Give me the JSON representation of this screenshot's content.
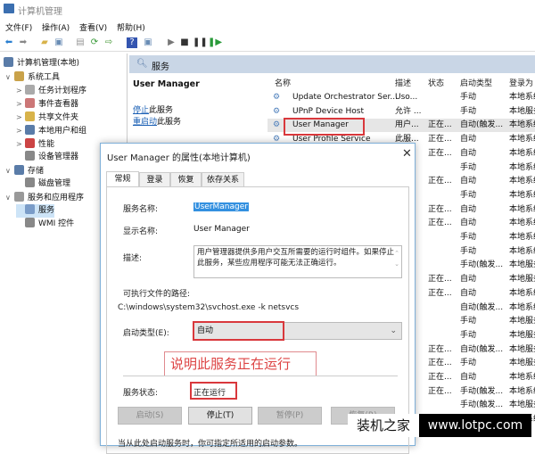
{
  "window": {
    "title": "计算机管理"
  },
  "menu": [
    "文件(F)",
    "操作(A)",
    "查看(V)",
    "帮助(H)"
  ],
  "toolbar": [
    {
      "icon": "back-arrow-icon",
      "g": "⬅",
      "c": "#2a7fd0"
    },
    {
      "icon": "forward-arrow-icon",
      "g": "➡",
      "c": "#888"
    },
    {
      "icon": "up-folder-icon",
      "g": "▰",
      "c": "#d8b34a"
    },
    {
      "icon": "show-hide-tree-icon",
      "g": "▣",
      "c": "#6a8db5"
    },
    {
      "icon": "properties-icon",
      "g": "▤",
      "c": "#999"
    },
    {
      "icon": "refresh-icon",
      "g": "⟳",
      "c": "#3a9a3a"
    },
    {
      "icon": "export-list-icon",
      "g": "⇨",
      "c": "#4a9a3a"
    },
    {
      "icon": "help-icon",
      "g": "?",
      "c": "#fff"
    },
    {
      "icon": "action-pane-icon",
      "g": "▣",
      "c": "#6a8db5"
    },
    {
      "icon": "play-icon",
      "g": "▶",
      "c": "#777"
    },
    {
      "icon": "stop-icon",
      "g": "■",
      "c": "#333"
    },
    {
      "icon": "pause-icon",
      "g": "❚❚",
      "c": "#333"
    },
    {
      "icon": "restart-icon",
      "g": "❚▶",
      "c": "#2a9a3a"
    }
  ],
  "tree": [
    {
      "label": "计算机管理(本地)",
      "level": 0,
      "chev": "",
      "color": "#5a7ca8"
    },
    {
      "label": "系统工具",
      "level": 1,
      "chev": "∨",
      "color": "#c9a24a"
    },
    {
      "label": "任务计划程序",
      "level": 2,
      "chev": ">",
      "color": "#aaa"
    },
    {
      "label": "事件查看器",
      "level": 2,
      "chev": ">",
      "color": "#c77"
    },
    {
      "label": "共享文件夹",
      "level": 2,
      "chev": ">",
      "color": "#d8b34a"
    },
    {
      "label": "本地用户和组",
      "level": 2,
      "chev": ">",
      "color": "#5a7ca8"
    },
    {
      "label": "性能",
      "level": 2,
      "chev": ">",
      "color": "#c44"
    },
    {
      "label": "设备管理器",
      "level": 2,
      "chev": "",
      "color": "#888"
    },
    {
      "label": "存储",
      "level": 1,
      "chev": "∨",
      "color": "#5a7ca8"
    },
    {
      "label": "磁盘管理",
      "level": 2,
      "chev": "",
      "color": "#888"
    },
    {
      "label": "服务和应用程序",
      "level": 1,
      "chev": "∨",
      "color": "#999"
    },
    {
      "label": "服务",
      "level": 2,
      "chev": "",
      "color": "#7a9cc8",
      "selected": true
    },
    {
      "label": "WMI 控件",
      "level": 2,
      "chev": "",
      "color": "#888"
    }
  ],
  "header": {
    "title": "服务"
  },
  "actions": {
    "service_name": "User Manager",
    "stop_link": "停止",
    "stop_suffix": "此服务",
    "restart_link": "重启动",
    "restart_suffix": "此服务"
  },
  "list": {
    "columns": [
      "名称",
      "描述",
      "状态",
      "启动类型",
      "登录为"
    ],
    "rows": [
      {
        "name": "Update Orchestrator Ser...",
        "desc": "Uso...",
        "status": "",
        "type": "手动",
        "logon": "本地系统"
      },
      {
        "name": "UPnP Device Host",
        "desc": "允许 ...",
        "status": "",
        "type": "手动",
        "logon": "本地服务"
      },
      {
        "name": "User Manager",
        "desc": "用户...",
        "status": "正在...",
        "type": "自动(触发...",
        "logon": "本地系统",
        "selected": true
      },
      {
        "name": "User Profile Service",
        "desc": "此服...",
        "status": "正在...",
        "type": "自动",
        "logon": "本地系统"
      },
      {
        "status": "正在...",
        "type": "自动",
        "logon": "本地系统"
      },
      {
        "status": "",
        "type": "手动",
        "logon": "本地系统"
      },
      {
        "status": "正在...",
        "type": "自动",
        "logon": "本地系统"
      },
      {
        "status": "",
        "type": "手动",
        "logon": "本地系统"
      },
      {
        "status": "正在...",
        "type": "自动",
        "logon": "本地系统"
      },
      {
        "status": "正在...",
        "type": "自动",
        "logon": "本地系统"
      },
      {
        "status": "",
        "type": "手动",
        "logon": "本地系统"
      },
      {
        "status": "",
        "type": "手动",
        "logon": "本地系统"
      },
      {
        "status": "",
        "type": "手动(触发...",
        "logon": "本地服务"
      },
      {
        "status": "正在...",
        "type": "自动",
        "logon": "本地服务"
      },
      {
        "status": "正在...",
        "type": "自动",
        "logon": "本地系统"
      },
      {
        "status": "",
        "type": "自动(触发...",
        "logon": "本地系统"
      },
      {
        "status": "",
        "type": "手动",
        "logon": "本地服务"
      },
      {
        "status": "",
        "type": "手动",
        "logon": "本地服务"
      },
      {
        "status": "正在...",
        "type": "自动(触发...",
        "logon": "本地服务"
      },
      {
        "status": "正在...",
        "type": "手动",
        "logon": "本地服务"
      },
      {
        "status": "正在...",
        "type": "自动",
        "logon": "本地系统"
      },
      {
        "status": "正在...",
        "type": "手动(触发...",
        "logon": "本地系统"
      },
      {
        "status": "",
        "type": "手动(触发...",
        "logon": "本地服务"
      },
      {
        "status": "",
        "type": "手动(触发...",
        "logon": "本地系统"
      }
    ]
  },
  "dialog": {
    "title": "User Manager 的属性(本地计算机)",
    "tabs": [
      "常规",
      "登录",
      "恢复",
      "依存关系"
    ],
    "service_name_label": "服务名称:",
    "service_name": "UserManager",
    "display_name_label": "显示名称:",
    "display_name": "User Manager",
    "desc_label": "描述:",
    "desc": "用户管理器提供多用户交互所需要的运行时组件。如果停止此服务，某些应用程序可能无法正确运行。",
    "path_label": "可执行文件的路径:",
    "path": "C:\\windows\\system32\\svchost.exe -k netsvcs",
    "startup_label": "启动类型(E):",
    "startup_value": "自动",
    "annotation": "说明此服务正在运行",
    "status_label": "服务状态:",
    "status_value": "正在运行",
    "buttons": {
      "start": "启动(S)",
      "stop": "停止(T)",
      "pause": "暂停(P)",
      "resume": "恢复(R)"
    },
    "footer": "当从此处启动服务时，你可指定所适用的启动参数。"
  },
  "watermark": {
    "cn": "装机之家",
    "url": "www.lotpc.com"
  }
}
